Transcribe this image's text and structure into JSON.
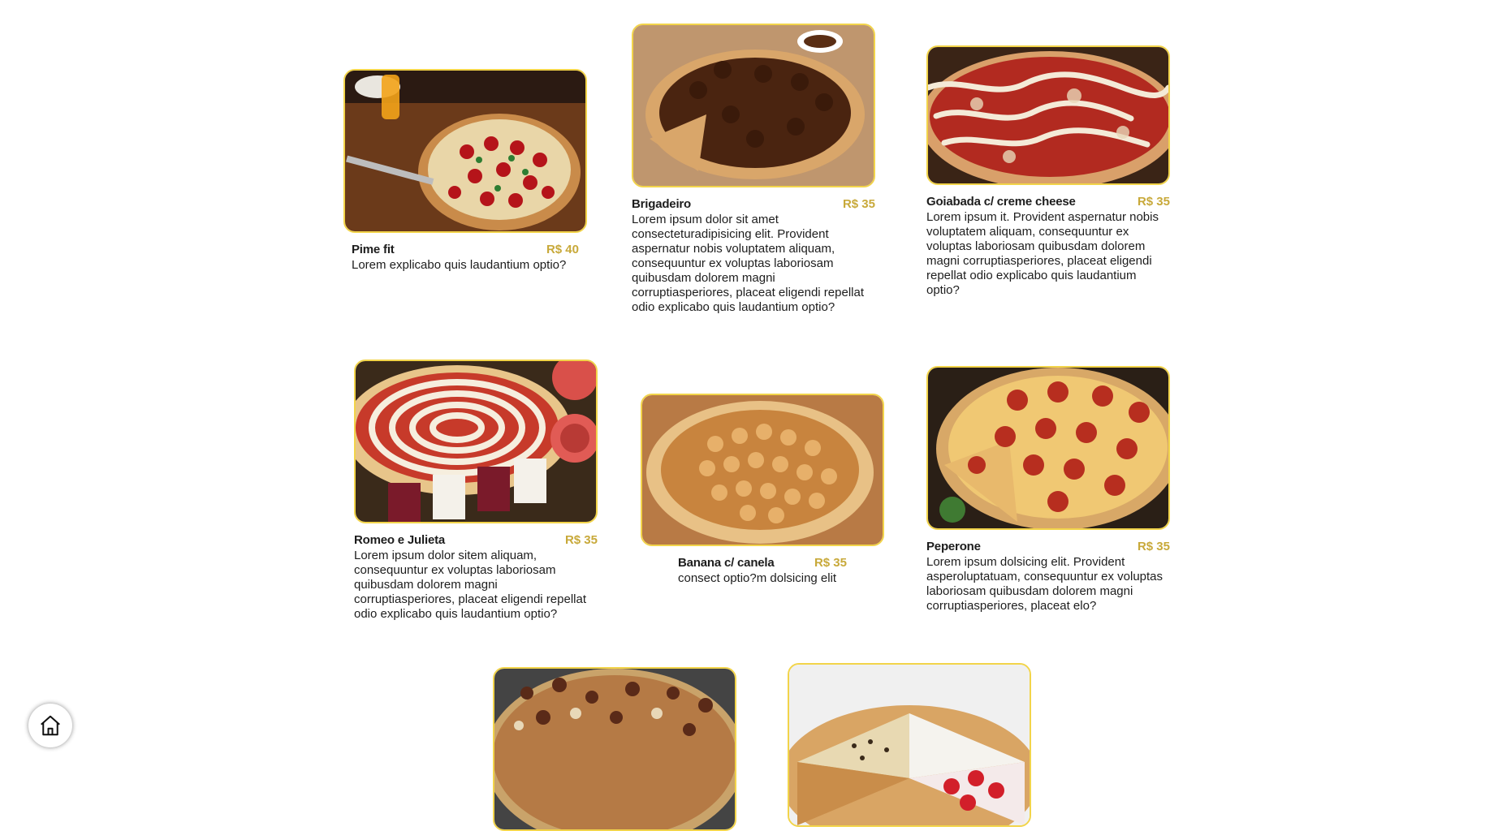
{
  "menu": {
    "items": [
      {
        "name": "Pime fit",
        "price": "R$ 40",
        "description": "Lorem explicabo quis laudantium optio?"
      },
      {
        "name": "Brigadeiro",
        "price": "R$ 35",
        "description": "Lorem ipsum dolor sit amet consecteturadipisicing elit. Provident aspernatur nobis voluptatem aliquam, consequuntur ex voluptas laboriosam quibusdam dolorem magni corruptiasperiores, placeat eligendi repellat odio explicabo quis laudantium optio?"
      },
      {
        "name": "Goiabada c/ creme cheese",
        "price": "R$ 35",
        "description": "Lorem ipsum it. Provident aspernatur nobis voluptatem aliquam, consequuntur ex voluptas laboriosam quibusdam dolorem magni corruptiasperiores, placeat eligendi repellat odio explicabo quis laudantium optio?"
      },
      {
        "name": "Romeo e Julieta",
        "price": "R$ 35",
        "description": "Lorem ipsum dolor sitem aliquam, consequuntur ex voluptas laboriosam quibusdam dolorem magni corruptiasperiores, placeat eligendi repellat odio explicabo quis laudantium optio?"
      },
      {
        "name": "Banana c/ canela",
        "price": "R$ 35",
        "description": "consect optio?m dolsicing elit"
      },
      {
        "name": "Peperone",
        "price": "R$ 35",
        "description": "Lorem ipsum dolsicing elit. Provident asperoluptatuam, consequuntur ex voluptas laboriosam quibusdam dolorem magni corruptiasperiores, placeat elo?"
      }
    ]
  },
  "home_button": {
    "icon": "home-icon"
  },
  "colors": {
    "accent_border": "#f2d44a",
    "price": "#c8a93a"
  }
}
